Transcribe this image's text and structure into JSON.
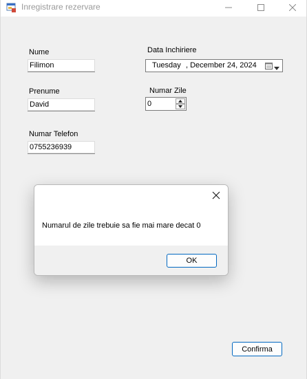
{
  "window": {
    "title": "Inregistrare rezervare",
    "icon": "form-app-icon"
  },
  "form": {
    "nume_label": "Nume",
    "nume_value": "Filimon",
    "prenume_label": "Prenume",
    "prenume_value": "David",
    "telefon_label": "Numar Telefon",
    "telefon_value": "0755236939",
    "data_label": "Data Inchiriere",
    "data_day": "Tuesday",
    "data_date": ", December 24, 2024",
    "zile_label": "Numar Zile",
    "zile_value": "0",
    "confirm_label": "Confirma"
  },
  "dialog": {
    "message": "Numarul de zile trebuie sa fie mai mare decat 0",
    "ok_label": "OK"
  },
  "colors": {
    "accent": "#0067c0",
    "window_bg": "#f0f0f0"
  }
}
